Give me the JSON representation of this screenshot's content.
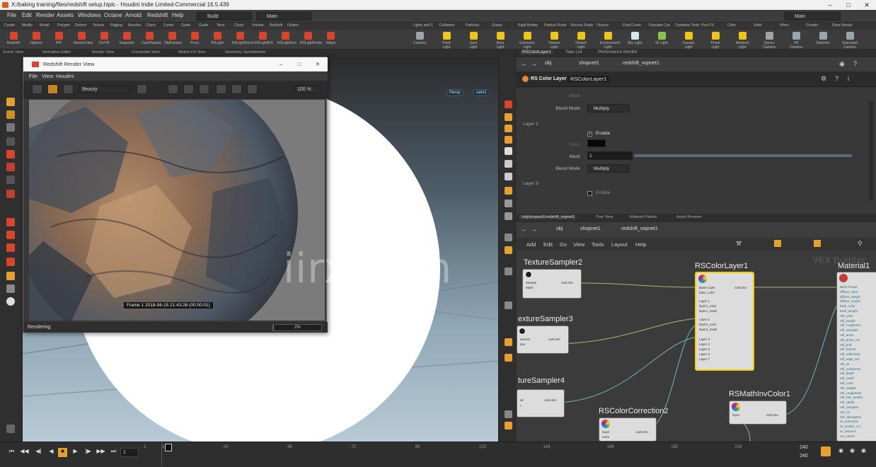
{
  "window": {
    "title": "X:/baking training/files/redshift setup.hiplc - Houdini Indie Limited-Commercial 16.5.439"
  },
  "menubar": {
    "items": [
      "File",
      "Edit",
      "Render",
      "Assets",
      "Windows",
      "Octane",
      "Arnold",
      "Redshift",
      "Help"
    ],
    "build_combo": "Build",
    "main_combo": "Main",
    "main_right": "Main"
  },
  "shelf": {
    "left_tabs": [
      "Create",
      "Modify",
      "Model",
      "Polygon",
      "Deform",
      "Texture",
      "Rigging",
      "Muscles",
      "Chara",
      "Constr",
      "Guide",
      "Guide",
      "Terra",
      "Cloud",
      "Volume",
      "Redshift",
      "Octane"
    ],
    "right_tabs": [
      "Lights and C",
      "Collisions",
      "Particles",
      "Grains",
      "Rigid Bodies",
      "Particle Fluids",
      "Viscous Fluids",
      "Oceans",
      "Fluid Conta",
      "Populate Con",
      "Container Tools",
      "Pyro FX",
      "Cloth",
      "Solid",
      "Wires",
      "Crowds",
      "Drive Simula"
    ],
    "left_tools": [
      {
        "label": "Redshift",
        "color": "#d9452b"
      },
      {
        "label": "Options",
        "color": "#d9452b"
      },
      {
        "label": "IPR",
        "color": "#d9452b"
      },
      {
        "label": "RenderView",
        "color": "#d9452b"
      },
      {
        "label": "On/Off",
        "color": "#d9452b"
      },
      {
        "label": "Snapshot",
        "color": "#d9452b"
      },
      {
        "label": "CamParams",
        "color": "#d9452b"
      },
      {
        "label": "ObjParams",
        "color": "#d9452b"
      },
      {
        "label": "Proxy",
        "color": "#d9452b"
      },
      {
        "label": "RSLight",
        "color": "#d9452b"
      },
      {
        "label": "RSLightDome",
        "color": "#d9452b"
      },
      {
        "label": "RSLightIES",
        "color": "#d9452b"
      },
      {
        "label": "RSLightSun",
        "color": "#d9452b"
      },
      {
        "label": "RSLightPortal",
        "color": "#d9452b"
      },
      {
        "label": "Vdbpx",
        "color": "#d9452b"
      }
    ],
    "right_tools": [
      {
        "label": "Camera",
        "color": "#9aa6ad"
      },
      {
        "label": "Point Light",
        "color": "#f0c419"
      },
      {
        "label": "Spot Light",
        "color": "#f0c419"
      },
      {
        "label": "Area Light",
        "color": "#f0c419"
      },
      {
        "label": "Geometry Light",
        "color": "#f0c419"
      },
      {
        "label": "Volume Light",
        "color": "#f0c419"
      },
      {
        "label": "Distant Light",
        "color": "#f0c419"
      },
      {
        "label": "Environment Light",
        "color": "#f0c419"
      },
      {
        "label": "Sky Light",
        "color": "#d8e6f0"
      },
      {
        "label": "GI Light",
        "color": "#8bc34a"
      },
      {
        "label": "Caustic Light",
        "color": "#f0c419"
      },
      {
        "label": "Portal Light",
        "color": "#f0c419"
      },
      {
        "label": "Ambient Light",
        "color": "#f0c419"
      },
      {
        "label": "Stereo Camera",
        "color": "#9aa6ad"
      },
      {
        "label": "VR Camera",
        "color": "#9aa6ad"
      },
      {
        "label": "Switcher",
        "color": "#9aa6ad"
      },
      {
        "label": "Gamepad Camera",
        "color": "#9aa6ad"
      }
    ]
  },
  "scene_tabs": [
    "Scene View",
    "Animation Editor",
    "Render View",
    "Composite View",
    "Motion FX View",
    "Geometry Spreadsheet"
  ],
  "viewport": {
    "cam_left": "Persp",
    "cam_right": "cam1",
    "network_label": "1_M"
  },
  "render_view": {
    "title": "Redshift Render View",
    "menu": [
      "File",
      "View",
      "Houdini"
    ],
    "aov": "Beauty",
    "zoom": "100 %",
    "frame_info": "Frame  1  2018-06-15  21:43:28  (00:00:01)",
    "status": "Rendering",
    "progress_text": "2%",
    "progress": 0.02
  },
  "watermark": "iirx.com",
  "param_tabs": [
    "RSColorLayer1",
    "Take List",
    "Performance Monitor"
  ],
  "param_path": [
    "obj",
    "shopnet1",
    "redshift_vopnet1"
  ],
  "param_header": {
    "type": "RS Color Layer",
    "name": "RSColorLayer1"
  },
  "params": {
    "mask_faded": "Mask",
    "blend_label": "Blend Mode",
    "blend_value": "Multiply",
    "layer2": "Layer 2",
    "enable": "Enable",
    "color_label": "Color",
    "mask_label": "Mask",
    "mask_value": "1",
    "blend2_label": "Blend Mode",
    "blend2_value": "Multiply",
    "layer3": "Layer 3",
    "enable3": "Enable"
  },
  "network_tabs": [
    "/obj/shopnet1/redshift_vopnet1",
    "Tree View",
    "Material Palette",
    "Asset Browser"
  ],
  "network_path": [
    "obj",
    "shopnet1",
    "redshift_vopnet1"
  ],
  "network_menu": [
    "Add",
    "Edit",
    "Go",
    "View",
    "Tools",
    "Layout",
    "Help"
  ],
  "network_badge": "VEX Builder",
  "nodes": {
    "ts2": {
      "title": "TextureSampler2",
      "ports_in": [
        "Sample",
        "Mask"
      ],
      "port_out": "outColor"
    },
    "ts3": {
      "title": "extureSampler3",
      "ports_in": [
        "ameral",
        "tput"
      ],
      "port_out": "outColor"
    },
    "ts4": {
      "title": "tureSampler4",
      "ports_in": [
        "ak",
        "t"
      ],
      "port_out": "outColor"
    },
    "cl1": {
      "title": "RSColorLayer1",
      "ports": [
        "Base Layer",
        "base_color",
        "Layer 1",
        "layer1_color",
        "layer1_mask",
        "Layer 2",
        "layer2_color",
        "layer2_mask",
        "Layer 3",
        "Layer 4",
        "Layer 5",
        "Layer 6",
        "Layer 7"
      ],
      "port_out": "outColor"
    },
    "cc2": {
      "title": "RSColorCorrection2",
      "ports_in": [
        "input",
        "more"
      ],
      "port_out": "outColor"
    },
    "mic1": {
      "title": "RSMathInvColor1",
      "ports_in": [
        "input"
      ],
      "port_out": "outColor"
    },
    "mat1": {
      "title": "Material1",
      "ports": [
        "Base Proper",
        "diffuse_color",
        "diffuse_weight",
        "diffuse_roughn",
        "back_color",
        "back_weight",
        "refl_color",
        "refl_weight",
        "refl_roughness",
        "refl_samples",
        "refl_aniso",
        "refl_aniso_rot",
        "refl_brdf",
        "refl_fresnel",
        "refl_reflectivity",
        "refl_edge_tint",
        "refl_ior",
        "refl_metalness",
        "refl_depth",
        "refl_cutoff",
        "refr_color",
        "refr_weight",
        "refr_roughness",
        "refr_thin_walled",
        "refr_depth",
        "refr_samples",
        "refr_ior",
        "refr_absorption",
        "ss_extinction",
        "ss_scatter_col",
        "ss_amount",
        "ms_color0"
      ]
    }
  },
  "timeline": {
    "ticks": [
      "1",
      "24",
      "48",
      "72",
      "96",
      "120",
      "144",
      "168",
      "192",
      "216"
    ],
    "current_frame": "1",
    "start": "1",
    "end_top": "240",
    "end_bottom": "240"
  },
  "colors": {
    "accent": "#e8a33d",
    "node_select": "#f0d000",
    "wire": "#b5b36a",
    "wire_blue": "#6fb6b6"
  }
}
